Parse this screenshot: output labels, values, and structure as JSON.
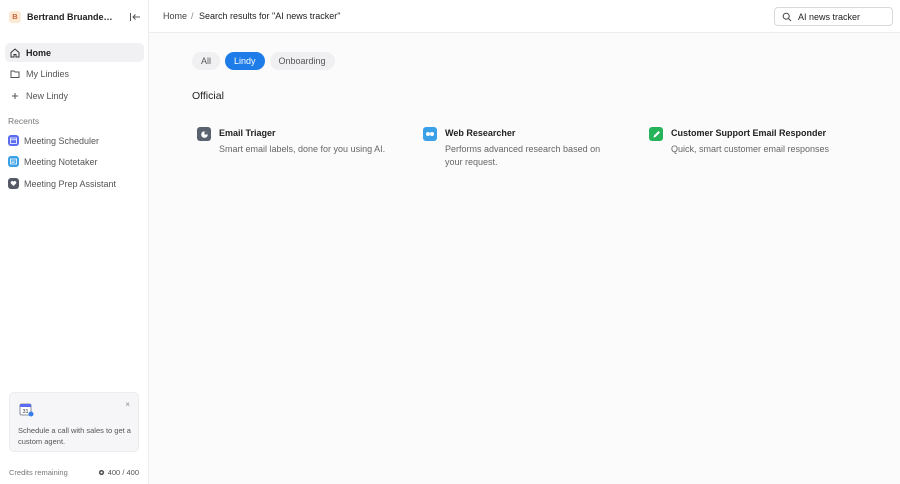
{
  "workspace": {
    "initial": "B",
    "name": "Bertrand Bruandet's..."
  },
  "nav": [
    {
      "label": "Home",
      "icon": "home-icon",
      "active": true
    },
    {
      "label": "My Lindies",
      "icon": "folder-icon"
    },
    {
      "label": "New Lindy",
      "icon": "plus-icon"
    }
  ],
  "recents": {
    "label": "Recents",
    "items": [
      {
        "label": "Meeting Scheduler",
        "color": "#5b6cf0"
      },
      {
        "label": "Meeting Notetaker",
        "color": "#3aa0e8"
      },
      {
        "label": "Meeting Prep Assistant",
        "color": "#555a66"
      }
    ]
  },
  "promo": {
    "text": "Schedule a call with sales to get a custom agent.",
    "close": "×",
    "calendar_digit": "31"
  },
  "credits": {
    "label": "Credits remaining",
    "value": "400 / 400"
  },
  "breadcrumb": {
    "home": "Home",
    "separator": "/",
    "current": "Search results for \"AI news tracker\""
  },
  "search": {
    "value": "AI news tracker"
  },
  "tabs": [
    {
      "label": "All",
      "active": false
    },
    {
      "label": "Lindy",
      "active": true
    },
    {
      "label": "Onboarding",
      "active": false
    }
  ],
  "section_title": "Official",
  "cards": [
    {
      "title": "Email Triager",
      "desc": "Smart email labels, done for you using AI.",
      "color": "#5a6270"
    },
    {
      "title": "Web Researcher",
      "desc": "Performs advanced research based on your request.",
      "color": "#3aa0e8"
    },
    {
      "title": "Customer Support Email Responder",
      "desc": "Quick, smart customer email responses",
      "color": "#27b35a"
    }
  ],
  "colors": {
    "accent": "#1d7ce8"
  }
}
